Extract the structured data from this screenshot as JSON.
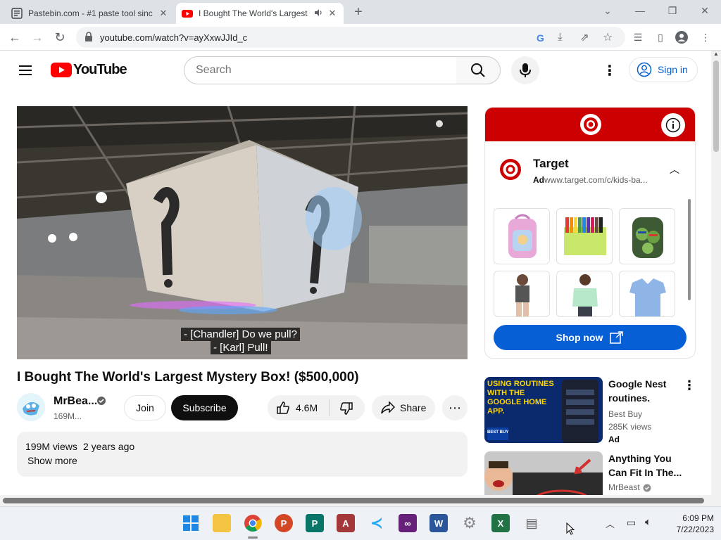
{
  "browser": {
    "tabs": [
      {
        "title": "Pastebin.com - #1 paste tool sinc",
        "active": false
      },
      {
        "title": "I Bought The World's Largest",
        "active": true
      }
    ],
    "url": "youtube.com/watch?v=ayXxwJJId_c"
  },
  "youtube": {
    "logo_text": "YouTube",
    "search_placeholder": "Search",
    "signin_label": "Sign in"
  },
  "video": {
    "captions": [
      "- [Chandler] Do we pull?",
      "- [Karl] Pull!"
    ],
    "title": "I Bought The World's Largest Mystery Box! ($500,000)",
    "channel": "MrBea...",
    "subscribers": "169M...",
    "join_label": "Join",
    "subscribe_label": "Subscribe",
    "likes": "4.6M",
    "share_label": "Share",
    "views": "199M views",
    "age": "2 years ago",
    "show_more": "Show more"
  },
  "ad": {
    "brand": "Target",
    "label": "Ad",
    "url": "www.target.com/c/kids-ba...",
    "cta": "Shop now"
  },
  "recommendations": [
    {
      "title_lines": [
        "Google Nest",
        "routines."
      ],
      "thumb_text": "USING ROUTINES WITH THE GOOGLE HOME APP.",
      "thumb_badge": "BEST BUY",
      "channel": "Best Buy",
      "views": "285K views",
      "badge": "Ad"
    },
    {
      "title_lines": [
        "Anything You",
        "Can Fit In The..."
      ],
      "channel": "MrBeast"
    }
  ],
  "taskbar": {
    "time": "6:09 PM",
    "date": "7/22/2023"
  },
  "colors": {
    "youtube_red": "#ff0000",
    "target_red": "#cc0000",
    "link_blue": "#065fd4"
  }
}
